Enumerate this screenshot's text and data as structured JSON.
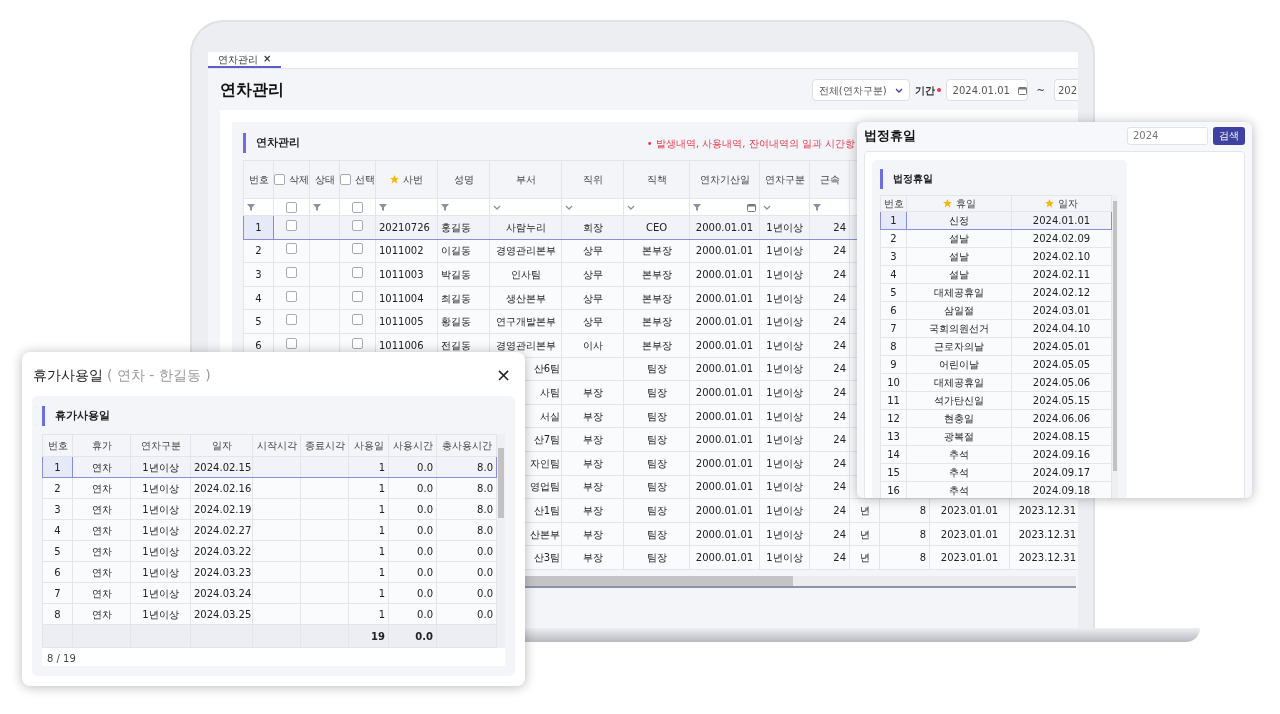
{
  "tab": {
    "label": "연차관리",
    "close": "×",
    "selected": true
  },
  "page_title": "연차관리",
  "filters": {
    "category": "전체(연차구분)",
    "period_label": "기간",
    "period_required": true,
    "date_from": "2024.01.01",
    "separator": "~",
    "date_to": "202"
  },
  "panel": {
    "title": "연차관리",
    "note": "• 발생내역, 사용내역, 잔여내역의 일과 시간항"
  },
  "table": {
    "columns": [
      {
        "label": "번호",
        "filter": {
          "kind": "funnel"
        }
      },
      {
        "label": "삭제",
        "kind": "check",
        "checked": false,
        "filter": {
          "kind": "check",
          "checked": false
        }
      },
      {
        "label": "상태",
        "filter": {
          "kind": "funnel"
        }
      },
      {
        "label": "선택",
        "kind": "check",
        "checked": false,
        "filter": {
          "kind": "check",
          "checked": false
        }
      },
      {
        "label": "사번",
        "star": true,
        "filter": {
          "kind": "funnel"
        }
      },
      {
        "label": "성명",
        "filter": {
          "kind": "funnel"
        }
      },
      {
        "label": "부서",
        "filter": {
          "kind": "chevron"
        }
      },
      {
        "label": "직위",
        "filter": {
          "kind": "chevron"
        }
      },
      {
        "label": "직책",
        "filter": {
          "kind": "chevron"
        }
      },
      {
        "label": "연차기산일",
        "filter": {
          "kind": "date"
        }
      },
      {
        "label": "연차구분",
        "filter": {
          "kind": "chevron"
        }
      },
      {
        "label": "근속",
        "filter": {
          "kind": "funnel"
        }
      }
    ],
    "rows": [
      {
        "selected": true,
        "no": "1",
        "delete_checked": false,
        "select_checked": false,
        "emp_id": "20210726",
        "name": "홍길동",
        "dept": "사람누리",
        "position": "회장",
        "role": "CEO",
        "start": "2000.01.01",
        "leave_type": "1년이상",
        "years": "24"
      },
      {
        "selected": false,
        "no": "2",
        "delete_checked": false,
        "select_checked": false,
        "emp_id": "1011002",
        "name": "이길동",
        "dept": "경영관리본부",
        "position": "상무",
        "role": "본부장",
        "start": "2000.01.01",
        "leave_type": "1년이상",
        "years": "24"
      },
      {
        "selected": false,
        "no": "3",
        "delete_checked": false,
        "select_checked": false,
        "emp_id": "1011003",
        "name": "박길동",
        "dept": "인사팀",
        "position": "상무",
        "role": "본부장",
        "start": "2000.01.01",
        "leave_type": "1년이상",
        "years": "24"
      },
      {
        "selected": false,
        "no": "4",
        "delete_checked": false,
        "select_checked": false,
        "emp_id": "1011004",
        "name": "최길동",
        "dept": "생산본부",
        "position": "상무",
        "role": "본부장",
        "start": "2000.01.01",
        "leave_type": "1년이상",
        "years": "24"
      },
      {
        "selected": false,
        "no": "5",
        "delete_checked": false,
        "select_checked": false,
        "emp_id": "1011005",
        "name": "황길동",
        "dept": "연구개발본부",
        "position": "상무",
        "role": "본부장",
        "start": "2000.01.01",
        "leave_type": "1년이상",
        "years": "24"
      },
      {
        "selected": false,
        "no": "6",
        "delete_checked": false,
        "select_checked": false,
        "emp_id": "1011006",
        "name": "전길동",
        "dept": "경영관리본부",
        "position": "이사",
        "role": "본부장",
        "start": "2000.01.01",
        "leave_type": "1년이상",
        "years": "24"
      },
      {
        "dept": "산6팀",
        "role": "팀장",
        "start": "2000.01.01",
        "leave_type": "1년이상",
        "years": "24"
      },
      {
        "dept": "사팀",
        "position": "부장",
        "role": "팀장",
        "start": "2000.01.01",
        "leave_type": "1년이상",
        "years": "24"
      },
      {
        "dept": "서실",
        "position": "부장",
        "role": "팀장",
        "start": "2000.01.01",
        "leave_type": "1년이상",
        "years": "24"
      },
      {
        "dept": "산7팀",
        "position": "부장",
        "role": "팀장",
        "start": "2000.01.01",
        "leave_type": "1년이상",
        "years": "24"
      },
      {
        "dept": "자인팀",
        "position": "부장",
        "role": "팀장",
        "start": "2000.01.01",
        "leave_type": "1년이상",
        "years": "24"
      },
      {
        "dept": "영업팀",
        "position": "부장",
        "role": "팀장",
        "start": "2000.01.01",
        "leave_type": "1년이상",
        "years": "24"
      },
      {
        "dept": "산1팀",
        "position": "부장",
        "role": "팀장",
        "start": "2000.01.01",
        "leave_type": "1년이상",
        "years": "24",
        "unit": "년",
        "days": "8",
        "from": "2023.01.01",
        "to": "2023.12.31"
      },
      {
        "dept": "산본부",
        "position": "부장",
        "role": "팀장",
        "start": "2000.01.01",
        "leave_type": "1년이상",
        "years": "24",
        "unit": "년",
        "days": "8",
        "from": "2023.01.01",
        "to": "2023.12.31"
      },
      {
        "dept": "산3팀",
        "position": "부장",
        "role": "팀장",
        "start": "2000.01.01",
        "leave_type": "1년이상",
        "years": "24",
        "unit": "년",
        "days": "8",
        "from": "2023.01.01",
        "to": "2023.12.31"
      }
    ]
  },
  "leave_dialog": {
    "title": "휴가사용일",
    "subtitle": "( 연차 - 한길동 )",
    "close": "×",
    "section": "휴가사용일",
    "columns": [
      "번호",
      "휴가",
      "연차구분",
      "일자",
      "시작시각",
      "종료시각",
      "사용일",
      "사용시간",
      "총사용시간"
    ],
    "rows": [
      {
        "selected": true,
        "no": "1",
        "type": "연차",
        "leave_type": "1년이상",
        "date": "2024.02.15",
        "days": "1",
        "hours": "0.0",
        "total": "8.0"
      },
      {
        "selected": false,
        "no": "2",
        "type": "연차",
        "leave_type": "1년이상",
        "date": "2024.02.16",
        "days": "1",
        "hours": "0.0",
        "total": "8.0"
      },
      {
        "selected": false,
        "no": "3",
        "type": "연차",
        "leave_type": "1년이상",
        "date": "2024.02.19",
        "days": "1",
        "hours": "0.0",
        "total": "8.0"
      },
      {
        "selected": false,
        "no": "4",
        "type": "연차",
        "leave_type": "1년이상",
        "date": "2024.02.27",
        "days": "1",
        "hours": "0.0",
        "total": "8.0"
      },
      {
        "selected": false,
        "no": "5",
        "type": "연차",
        "leave_type": "1년이상",
        "date": "2024.03.22",
        "days": "1",
        "hours": "0.0",
        "total": "0.0"
      },
      {
        "selected": false,
        "no": "6",
        "type": "연차",
        "leave_type": "1년이상",
        "date": "2024.03.23",
        "days": "1",
        "hours": "0.0",
        "total": "0.0"
      },
      {
        "selected": false,
        "no": "7",
        "type": "연차",
        "leave_type": "1년이상",
        "date": "2024.03.24",
        "days": "1",
        "hours": "0.0",
        "total": "0.0"
      },
      {
        "selected": false,
        "no": "8",
        "type": "연차",
        "leave_type": "1년이상",
        "date": "2024.03.25",
        "days": "1",
        "hours": "0.0",
        "total": "0.0"
      }
    ],
    "totals": {
      "days": "19",
      "hours": "0.0"
    },
    "status": "8 / 19"
  },
  "holiday_dialog": {
    "title": "법정휴일",
    "search_value": "2024",
    "search_button": "검색",
    "section": "법정휴일",
    "columns": [
      {
        "label": "번호"
      },
      {
        "label": "휴일",
        "star": true
      },
      {
        "label": "일자",
        "star": true
      }
    ],
    "rows": [
      {
        "selected": true,
        "no": "1",
        "name": "신정",
        "date": "2024.01.01"
      },
      {
        "selected": false,
        "no": "2",
        "name": "설날",
        "date": "2024.02.09"
      },
      {
        "selected": false,
        "no": "3",
        "name": "설날",
        "date": "2024.02.10"
      },
      {
        "selected": false,
        "no": "4",
        "name": "설날",
        "date": "2024.02.11"
      },
      {
        "selected": false,
        "no": "5",
        "name": "대체공휴일",
        "date": "2024.02.12"
      },
      {
        "selected": false,
        "no": "6",
        "name": "삼일절",
        "date": "2024.03.01"
      },
      {
        "selected": false,
        "no": "7",
        "name": "국회의원선거",
        "date": "2024.04.10"
      },
      {
        "selected": false,
        "no": "8",
        "name": "근로자의날",
        "date": "2024.05.01"
      },
      {
        "selected": false,
        "no": "9",
        "name": "어린이날",
        "date": "2024.05.05"
      },
      {
        "selected": false,
        "no": "10",
        "name": "대체공휴일",
        "date": "2024.05.06"
      },
      {
        "selected": false,
        "no": "11",
        "name": "석가탄신일",
        "date": "2024.05.15"
      },
      {
        "selected": false,
        "no": "12",
        "name": "현충일",
        "date": "2024.06.06"
      },
      {
        "selected": false,
        "no": "13",
        "name": "광복절",
        "date": "2024.08.15"
      },
      {
        "selected": false,
        "no": "14",
        "name": "추석",
        "date": "2024.09.16"
      },
      {
        "selected": false,
        "no": "15",
        "name": "추석",
        "date": "2024.09.17"
      },
      {
        "selected": false,
        "no": "16",
        "name": "추석",
        "date": "2024.09.18"
      }
    ]
  }
}
